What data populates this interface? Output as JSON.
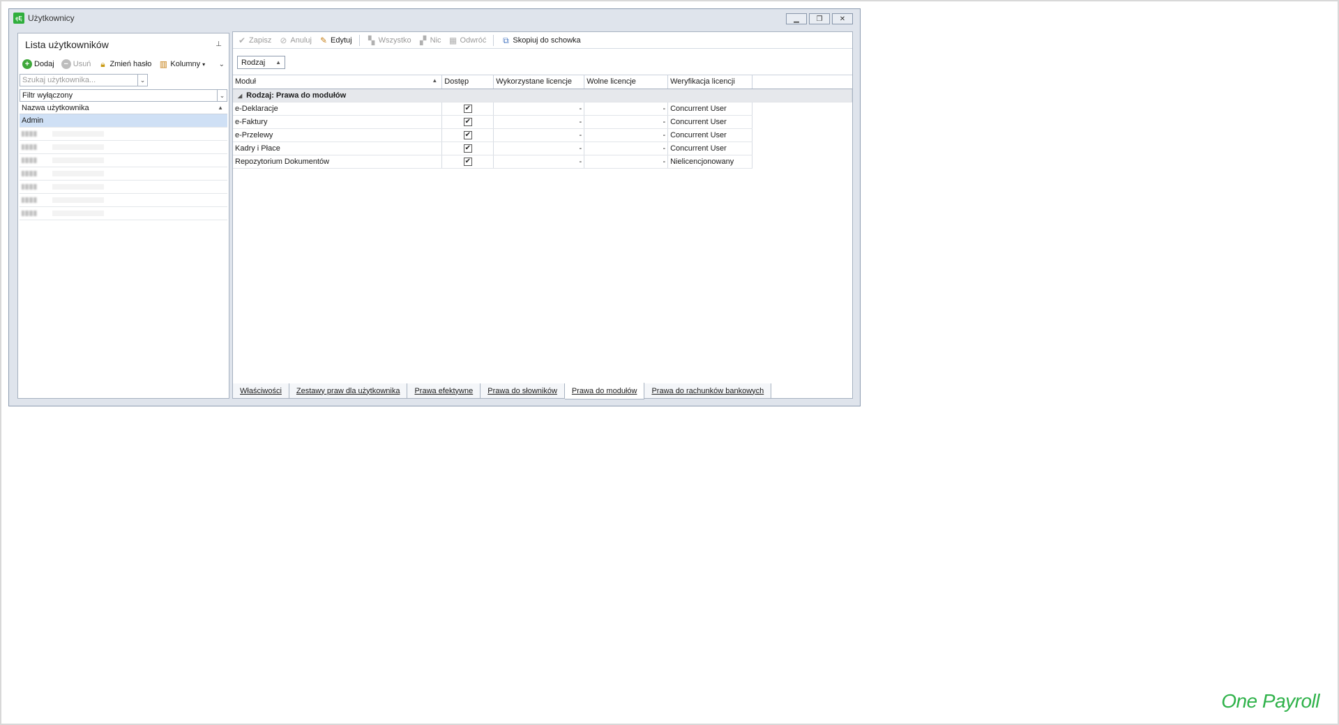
{
  "window": {
    "title": "Użytkownicy",
    "icon_text": "ęĘ"
  },
  "left_panel": {
    "title": "Lista użytkowników",
    "toolbar": {
      "add": "Dodaj",
      "delete": "Usuń",
      "change_password": "Zmień hasło",
      "columns": "Kolumny"
    },
    "search": {
      "placeholder": "Szukaj użytkownika..."
    },
    "filter": "Filtr wyłączony",
    "column_header": "Nazwa użytkownika",
    "users": [
      "Admin",
      "",
      "",
      "",
      "",
      "",
      "",
      ""
    ]
  },
  "right_panel": {
    "toolbar": {
      "save": "Zapisz",
      "cancel": "Anuluj",
      "edit": "Edytuj",
      "all": "Wszystko",
      "none": "Nic",
      "invert": "Odwróć",
      "copy": "Skopiuj do schowka"
    },
    "group_chip": "Rodzaj",
    "columns": [
      "Moduł",
      "Dostęp",
      "Wykorzystane licencje",
      "Wolne licencje",
      "Weryfikacja licencji"
    ],
    "group_label": "Rodzaj: Prawa do modułów",
    "rows": [
      {
        "module": "e-Deklaracje",
        "access": true,
        "used": "-",
        "free": "-",
        "verification": "Concurrent User"
      },
      {
        "module": "e-Faktury",
        "access": true,
        "used": "-",
        "free": "-",
        "verification": "Concurrent User"
      },
      {
        "module": "e-Przelewy",
        "access": true,
        "used": "-",
        "free": "-",
        "verification": "Concurrent User"
      },
      {
        "module": "Kadry i Płace",
        "access": true,
        "used": "-",
        "free": "-",
        "verification": "Concurrent User"
      },
      {
        "module": "Repozytorium Dokumentów",
        "access": true,
        "used": "-",
        "free": "-",
        "verification": "Nielicencjonowany"
      }
    ]
  },
  "tabs": [
    {
      "label": "Właściwości",
      "active": false
    },
    {
      "label": "Zestawy praw dla użytkownika",
      "active": false
    },
    {
      "label": "Prawa efektywne",
      "active": false
    },
    {
      "label": "Prawa do słowników",
      "active": false
    },
    {
      "label": "Prawa do modułów",
      "active": true
    },
    {
      "label": "Prawa do rachunków bankowych",
      "active": false
    }
  ],
  "brand": "One Payroll",
  "colors": {
    "brand": "#2fb24a",
    "selection": "#cfe0f5",
    "accent_green": "#3ea83a"
  }
}
